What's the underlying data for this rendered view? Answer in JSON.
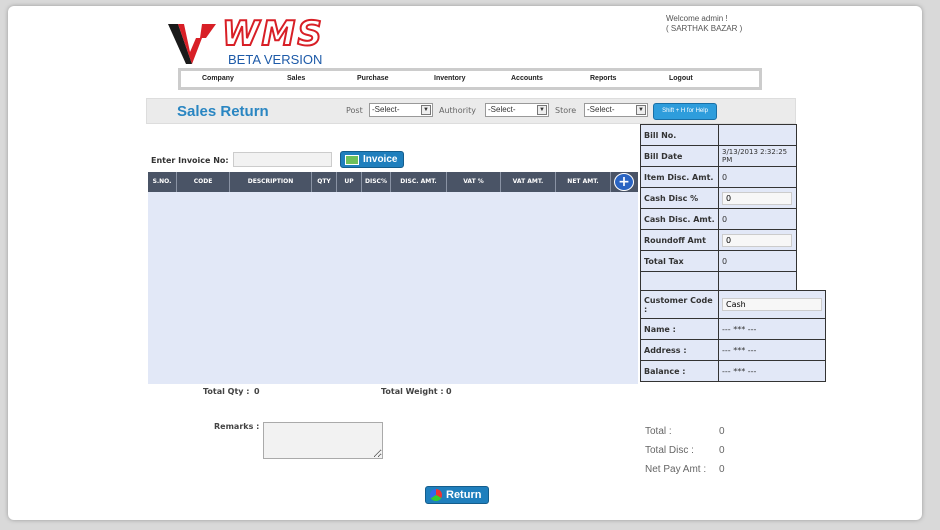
{
  "logo": {
    "text": "WMS",
    "subtitle": "BETA VERSION"
  },
  "welcome": {
    "line1": "Welcome admin !",
    "line2": "( SARTHAK BAZAR )"
  },
  "nav": [
    {
      "label": "Company"
    },
    {
      "label": "Sales"
    },
    {
      "label": "Purchase"
    },
    {
      "label": "Inventory"
    },
    {
      "label": "Accounts"
    },
    {
      "label": "Reports"
    },
    {
      "label": "Logout"
    }
  ],
  "titlebar": {
    "title": "Sales Return",
    "post_label": "Post",
    "post_value": "-Select-",
    "authority_label": "Authority",
    "authority_value": "-Select-",
    "store_label": "Store",
    "store_value": "-Select-",
    "help_label": "Shift + H for Help"
  },
  "invoice": {
    "label": "Enter Invoice No:",
    "value": "",
    "button": "Invoice"
  },
  "grid": {
    "columns": [
      "S.NO.",
      "CODE",
      "DESCRIPTION",
      "QTY",
      "UP",
      "DISC%",
      "DISC. AMT.",
      "VAT %",
      "VAT AMT.",
      "NET AMT."
    ]
  },
  "totals": {
    "qty_label": "Total Qty :",
    "qty": "0",
    "weight_label": "Total Weight :",
    "weight": "0"
  },
  "remarks": {
    "label": "Remarks :",
    "value": ""
  },
  "bill": {
    "bill_no_label": "Bill No.",
    "bill_no": "",
    "bill_date_label": "Bill Date",
    "bill_date": "3/13/2013 2:32:25 PM",
    "item_disc_label": "Item Disc. Amt.",
    "item_disc": "0",
    "cash_disc_pct_label": "Cash Disc %",
    "cash_disc_pct": "0",
    "cash_disc_amt_label": "Cash Disc. Amt.",
    "cash_disc_amt": "0",
    "roundoff_label": "Roundoff Amt",
    "roundoff": "0",
    "total_tax_label": "Total Tax",
    "total_tax": "0"
  },
  "customer": {
    "code_label": "Customer Code :",
    "code": "Cash",
    "name_label": "Name :",
    "name": "--- *** ---",
    "address_label": "Address :",
    "address": "--- *** ---",
    "balance_label": "Balance :",
    "balance": "--- *** ---"
  },
  "summary": {
    "total_label": "Total :",
    "total": "0",
    "total_disc_label": "Total Disc :",
    "total_disc": "0",
    "net_pay_label": "Net Pay Amt :",
    "net_pay": "0"
  },
  "return_button": "Return",
  "colors": {
    "accent": "#2a86c2",
    "header": "#4a5466",
    "grid_bg": "#e2e8f7",
    "logo_red": "#d81f26"
  }
}
